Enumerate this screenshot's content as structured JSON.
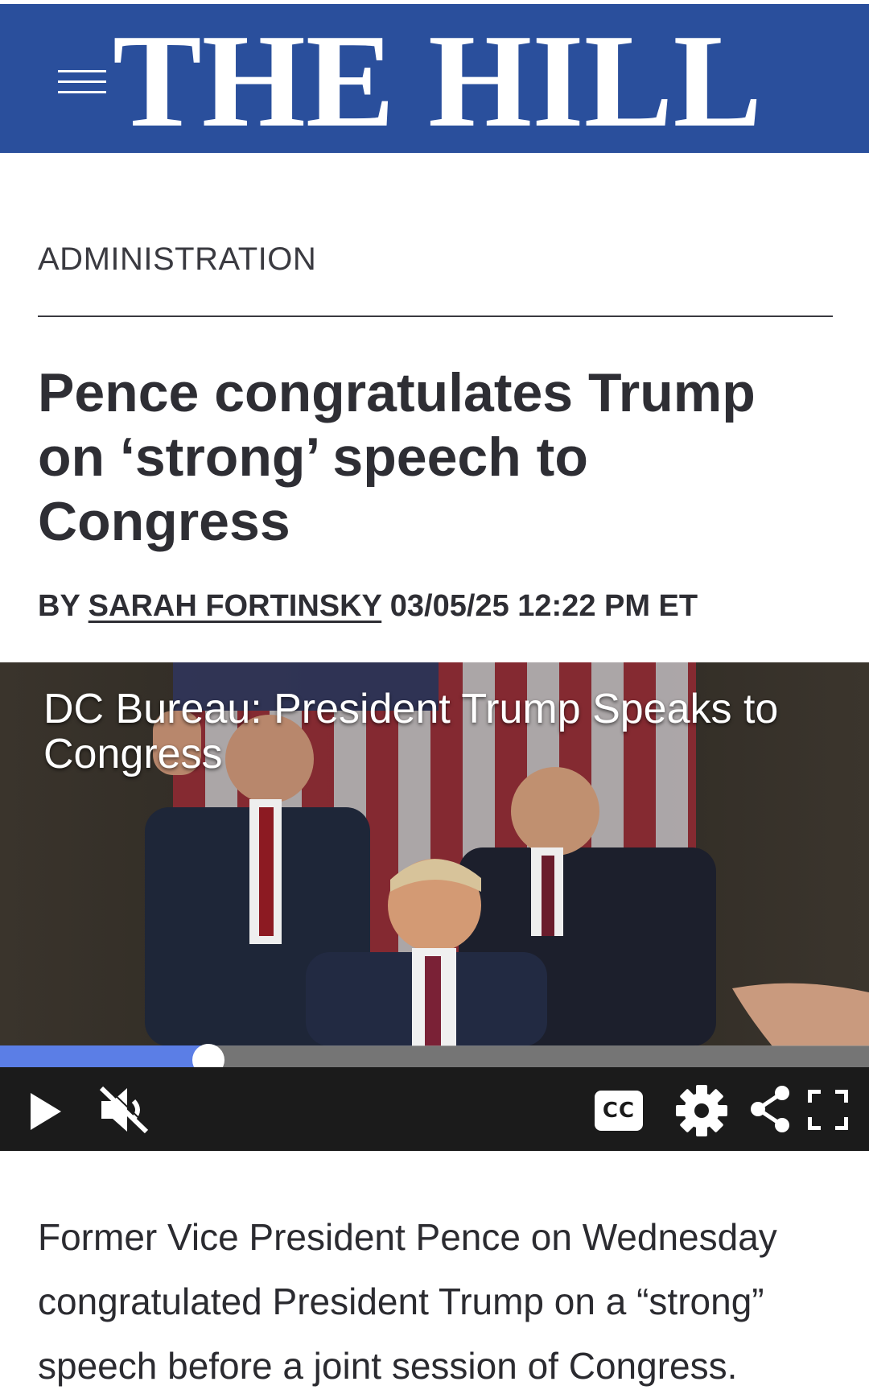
{
  "header": {
    "logo_text": "THE HILL",
    "brand_color": "#2a4f9c",
    "menu_icon": "hamburger-menu-icon"
  },
  "article": {
    "section": "ADMINISTRATION",
    "headline": "Pence congratulates Trump on ‘strong’ speech to Congress",
    "byline_prefix": "BY",
    "author": "SARAH FORTINSKY",
    "timestamp": "03/05/25 12:22 PM ET",
    "body_first_paragraph": "Former Vice President Pence on Wednesday congratulated President Trump on a “strong” speech before a joint session of Congress."
  },
  "video": {
    "title": "DC Bureau: President Trump Speaks to Congress",
    "progress_fraction": 0.24,
    "progress_color": "#5b7ee6",
    "controls": {
      "play": "play-icon",
      "mute": "muted-speaker-icon",
      "captions": "CC",
      "settings": "gear-icon",
      "share": "share-icon",
      "fullscreen": "fullscreen-icon"
    }
  }
}
